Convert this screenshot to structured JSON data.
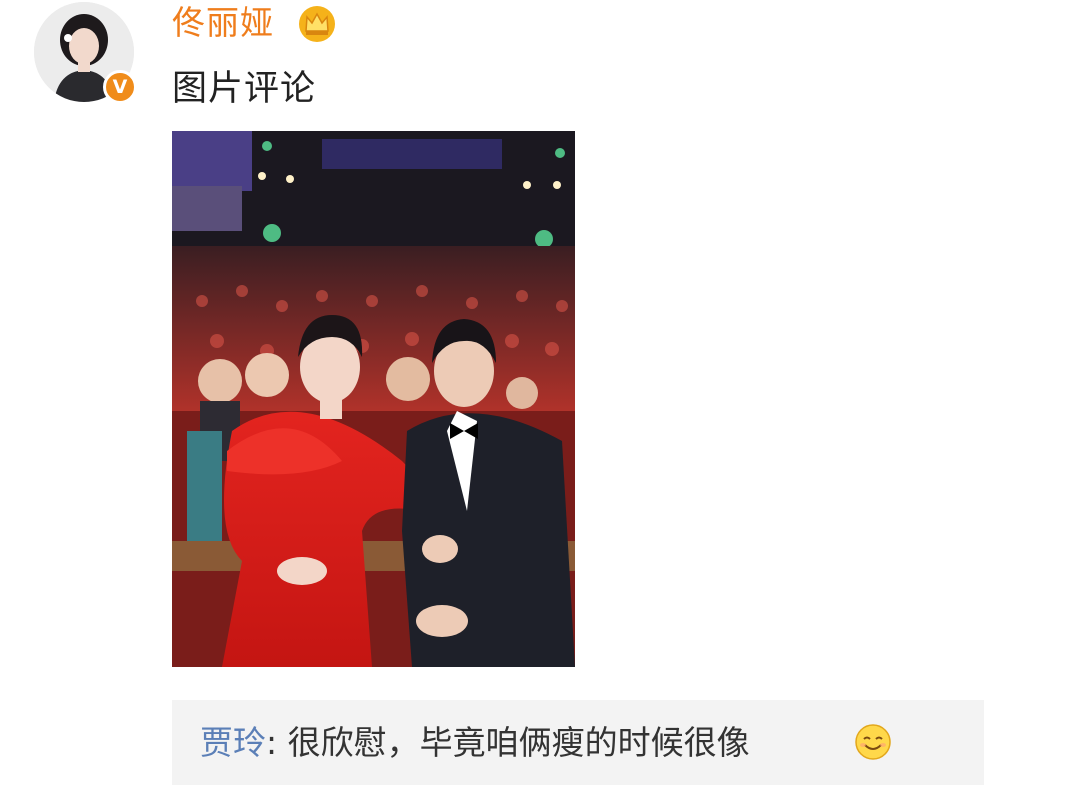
{
  "post": {
    "author": "佟丽娅",
    "text": "图片评论"
  },
  "comment": {
    "author": "贾玲",
    "separator": ":",
    "text": " 很欣慰，毕竟咱俩瘦的时候很像"
  },
  "icons": {
    "avatar": "avatar-photo",
    "verified": "verified-v-badge",
    "crown": "crown-icon",
    "emoji": "smile-emoji-icon"
  },
  "colors": {
    "author_name": "#ef7d1c",
    "verified_badge": "#f08c1a",
    "comment_author": "#5b7fb7",
    "comment_bg": "#f3f3f3"
  }
}
